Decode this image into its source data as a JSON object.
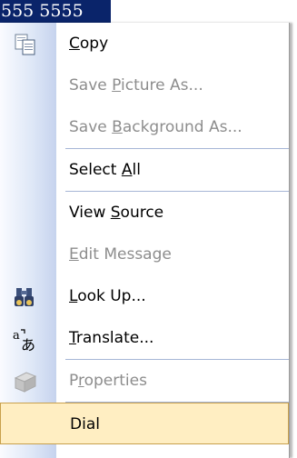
{
  "selection": {
    "text": "555 5555"
  },
  "menu": {
    "items": [
      {
        "id": "copy",
        "label": "Copy",
        "mnemonic": "C",
        "enabled": true,
        "icon": "copy-icon"
      },
      {
        "id": "save-picture",
        "label": "Save Picture As...",
        "mnemonic": "P",
        "enabled": false
      },
      {
        "id": "save-background",
        "label": "Save Background As...",
        "mnemonic": "B",
        "enabled": false
      },
      {
        "id": "select-all",
        "label": "Select All",
        "mnemonic": "A",
        "enabled": true
      },
      {
        "id": "view-source",
        "label": "View Source",
        "mnemonic": "S",
        "enabled": true
      },
      {
        "id": "edit-message",
        "label": "Edit Message",
        "mnemonic": "E",
        "enabled": false
      },
      {
        "id": "look-up",
        "label": "Look Up...",
        "mnemonic": "L",
        "enabled": true,
        "icon": "binoculars-icon"
      },
      {
        "id": "translate",
        "label": "Translate...",
        "mnemonic": "T",
        "enabled": true,
        "icon": "translate-icon"
      },
      {
        "id": "properties",
        "label": "Properties",
        "mnemonic": "r",
        "enabled": false,
        "icon": "properties-icon"
      },
      {
        "id": "dial",
        "label": "Dial",
        "enabled": true,
        "highlighted": true
      }
    ]
  },
  "colors": {
    "selection_bg": "#0a246a",
    "highlight_bg": "#ffeec2",
    "disabled_text": "#8d8d8d"
  }
}
